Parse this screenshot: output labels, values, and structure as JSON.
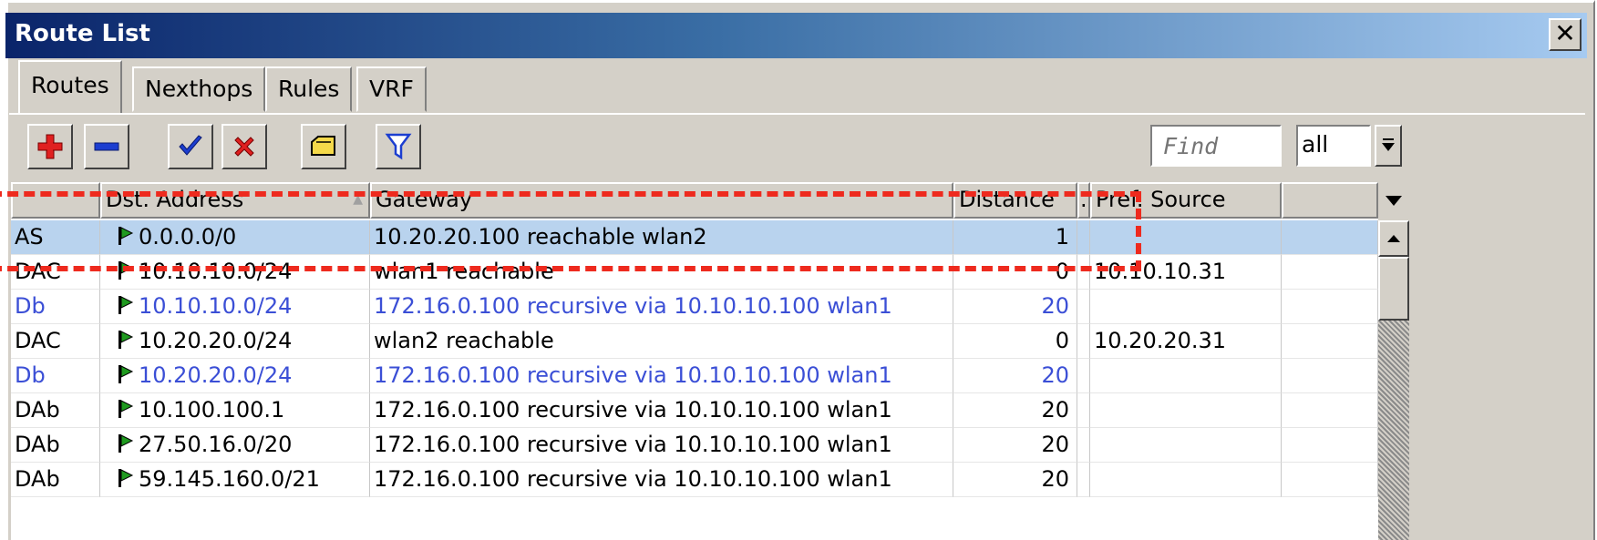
{
  "window": {
    "title": "Route List"
  },
  "tabs": [
    {
      "label": "Routes"
    },
    {
      "label": "Nexthops"
    },
    {
      "label": "Rules"
    },
    {
      "label": "VRF"
    }
  ],
  "toolbar": {
    "buttons": [
      {
        "icon": "plus-icon",
        "color": "#e02020"
      },
      {
        "icon": "minus-icon",
        "color": "#1c3ed0"
      },
      {
        "icon": "check-icon",
        "color": "#1c3ed0"
      },
      {
        "icon": "cross-icon",
        "color": "#e02020"
      },
      {
        "icon": "comment-icon",
        "color": "#f5d94a"
      },
      {
        "icon": "filter-icon",
        "color": "#1c3ed0"
      }
    ],
    "find_placeholder": "Find",
    "filter_value": "all"
  },
  "table": {
    "columns": [
      {
        "label": ""
      },
      {
        "label": "Dst. Address",
        "sort_indicator": "▲"
      },
      {
        "label": "Gateway"
      },
      {
        "label": "Distance"
      },
      {
        "label": "."
      },
      {
        "label": "Pref. Source"
      },
      {
        "label": ""
      }
    ],
    "rows": [
      {
        "flags": "AS",
        "dst": "0.0.0.0/0",
        "gateway": "10.20.20.100 reachable wlan2",
        "distance": "1",
        "pref_source": "",
        "selected": true,
        "style": "normal"
      },
      {
        "flags": "DAC",
        "dst": "10.10.10.0/24",
        "gateway": "wlan1 reachable",
        "distance": "0",
        "pref_source": "10.10.10.31",
        "selected": false,
        "style": "normal"
      },
      {
        "flags": "Db",
        "dst": "10.10.10.0/24",
        "gateway": "172.16.0.100 recursive via 10.10.10.100 wlan1",
        "distance": "20",
        "pref_source": "",
        "selected": false,
        "style": "blue"
      },
      {
        "flags": "DAC",
        "dst": "10.20.20.0/24",
        "gateway": "wlan2 reachable",
        "distance": "0",
        "pref_source": "10.20.20.31",
        "selected": false,
        "style": "normal"
      },
      {
        "flags": "Db",
        "dst": "10.20.20.0/24",
        "gateway": "172.16.0.100 recursive via 10.10.10.100 wlan1",
        "distance": "20",
        "pref_source": "",
        "selected": false,
        "style": "blue"
      },
      {
        "flags": "DAb",
        "dst": "10.100.100.1",
        "gateway": "172.16.0.100 recursive via 10.10.10.100 wlan1",
        "distance": "20",
        "pref_source": "",
        "selected": false,
        "style": "normal"
      },
      {
        "flags": "DAb",
        "dst": "27.50.16.0/20",
        "gateway": "172.16.0.100 recursive via 10.10.10.100 wlan1",
        "distance": "20",
        "pref_source": "",
        "selected": false,
        "style": "normal"
      },
      {
        "flags": "DAb",
        "dst": "59.145.160.0/21",
        "gateway": "172.16.0.100 recursive via 10.10.10.100 wlan1",
        "distance": "20",
        "pref_source": "",
        "selected": false,
        "style": "normal"
      }
    ]
  },
  "colors": {
    "highlight_dash": "#ee2a1e",
    "selected_row": "#b9d3ee",
    "blue_text": "#3b4fd6",
    "flag_green": "#1f9a1f"
  }
}
